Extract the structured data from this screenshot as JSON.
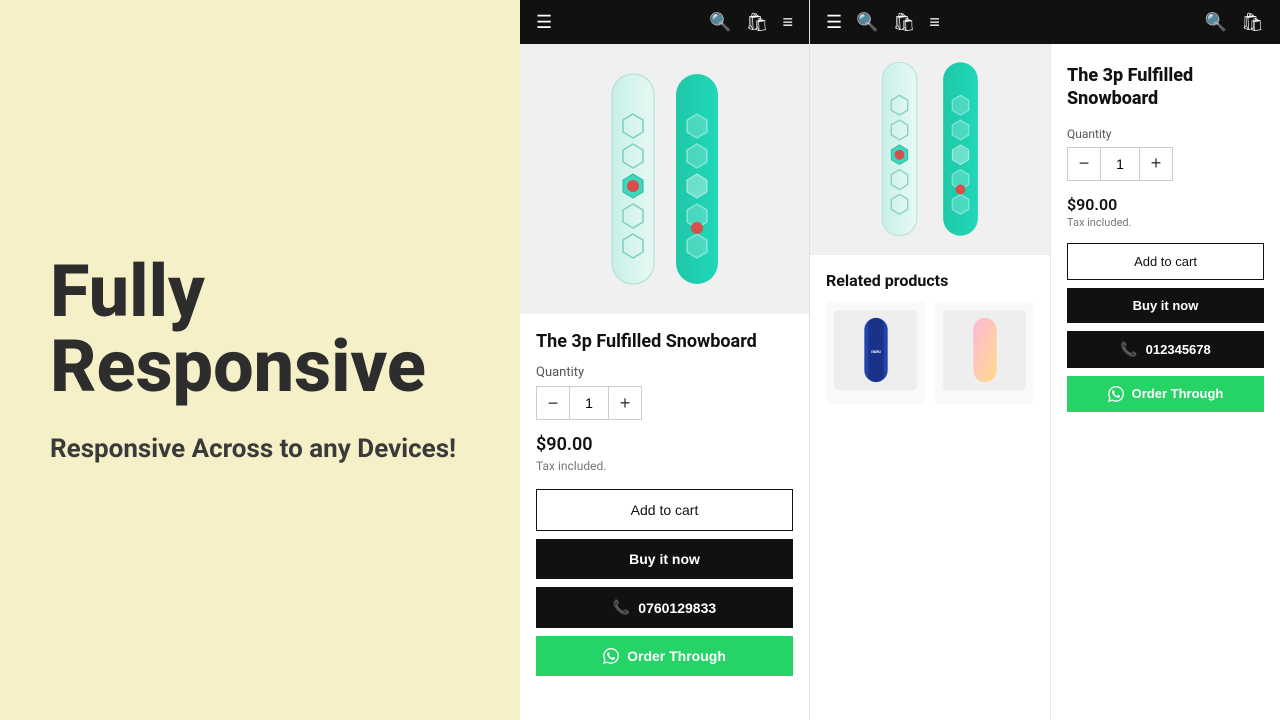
{
  "left": {
    "headline": "Fully\nResponsive",
    "subheadline": "Responsive Across to any Devices!"
  },
  "nav": {
    "left_icons": [
      "menu",
      "search",
      "cart",
      "lines"
    ],
    "right_icons": [
      "search",
      "cart"
    ]
  },
  "product": {
    "title": "The 3p Fulfilled Snowboard",
    "quantity_label": "Quantity",
    "qty_value": "1",
    "price": "$90.00",
    "tax_text": "Tax included.",
    "add_to_cart": "Add to cart",
    "buy_now": "Buy it now",
    "phone_number": "0760129833",
    "order_through": "Order Through",
    "whatsapp_number": "012345678"
  },
  "related": {
    "title": "Related products"
  }
}
